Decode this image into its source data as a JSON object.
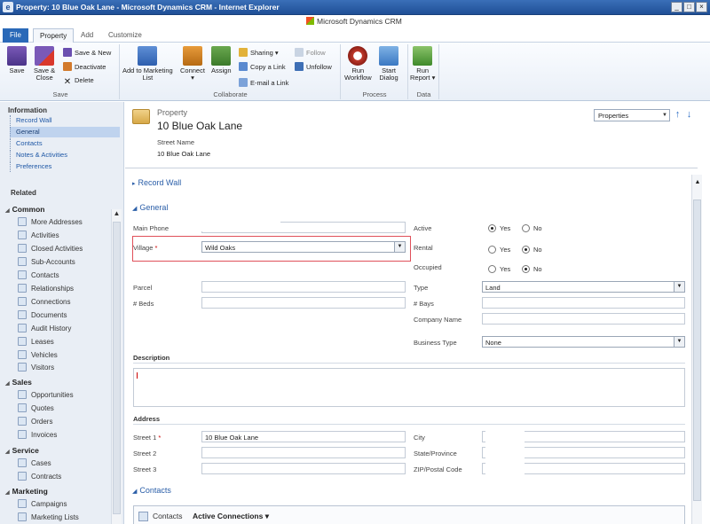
{
  "window": {
    "title": "Property: 10 Blue Oak Lane - Microsoft Dynamics CRM - Internet Explorer",
    "app_icon": "ie-icon",
    "controls": [
      "_",
      "□",
      "×"
    ]
  },
  "brand": {
    "logo_text": "Microsoft Dynamics CRM"
  },
  "ribbon_tabs": [
    "File",
    "Property",
    "Add",
    "Customize"
  ],
  "ribbon": {
    "save_group": {
      "label": "Save",
      "save": "Save",
      "save_close": [
        "Save &",
        "Close"
      ],
      "save_new": "Save & New",
      "deactivate": "Deactivate",
      "delete": "Delete"
    },
    "collaborate_group": {
      "label": "Collaborate",
      "add_marketing": [
        "Add to Marketing",
        "List"
      ],
      "connect": [
        "Connect",
        "▾"
      ],
      "assign": "Assign",
      "sharing": "Sharing ▾",
      "copy_link": "Copy a Link",
      "email_link": "E-mail a Link",
      "follow": "Follow",
      "unfollow": "Unfollow"
    },
    "process_group": {
      "label": "Process",
      "run_workflow": [
        "Run",
        "Workflow"
      ],
      "start_dialog": [
        "Start",
        "Dialog"
      ]
    },
    "data_group": {
      "label": "Data",
      "run_report": [
        "Run",
        "Report ▾"
      ]
    }
  },
  "nav": {
    "information_title": "Information",
    "information_items": [
      "Record Wall",
      "General",
      "Contacts",
      "Notes & Activities",
      "Preferences"
    ],
    "selected": "General",
    "related_title": "Related",
    "groups": [
      {
        "title": "Common",
        "items": [
          "More Addresses",
          "Activities",
          "Closed Activities",
          "Sub-Accounts",
          "Contacts",
          "Relationships",
          "Connections",
          "Documents",
          "Audit History",
          "Leases",
          "Vehicles",
          "Visitors"
        ]
      },
      {
        "title": "Sales",
        "items": [
          "Opportunities",
          "Quotes",
          "Orders",
          "Invoices"
        ]
      },
      {
        "title": "Service",
        "items": [
          "Cases",
          "Contracts"
        ]
      },
      {
        "title": "Marketing",
        "items": [
          "Campaigns",
          "Marketing Lists"
        ]
      }
    ]
  },
  "header": {
    "entity": "Property",
    "record_title": "10 Blue Oak Lane",
    "street_label": "Street Name",
    "street_value": "10 Blue Oak Lane",
    "form_selector": "Properties"
  },
  "sections": {
    "record_wall": "Record Wall",
    "general": "General",
    "description": "Description",
    "address": "Address",
    "contacts": "Contacts"
  },
  "general": {
    "main_phone_label": "Main Phone",
    "village_label": "Village",
    "village_value": "Wild Oaks",
    "parcel_label": "Parcel",
    "beds_label": "# Beds",
    "active_label": "Active",
    "active_options": [
      "Yes",
      "No"
    ],
    "active_value": "Yes",
    "rental_label": "Rental",
    "rental_value": "No",
    "occupied_label": "Occupied",
    "occupied_value": "No",
    "type_label": "Type",
    "type_value": "Land",
    "bays_label": "# Bays",
    "company_label": "Company Name",
    "business_type_label": "Business Type",
    "business_type_value": "None"
  },
  "address": {
    "street1_label": "Street 1",
    "street1_value": "10 Blue Oak Lane",
    "street2_label": "Street 2",
    "street3_label": "Street 3",
    "city_label": "City",
    "state_label": "State/Province",
    "zip_label": "ZIP/Postal Code"
  },
  "contacts_subgrid": {
    "label": "Contacts",
    "view": "Active Connections ▾"
  },
  "colors": {
    "titlebar": "#1f4f96",
    "file_tab": "#2a69b8",
    "link": "#1f58a6",
    "highlight_box": "#e0505a",
    "nav_selected": "#bfd3ee"
  }
}
